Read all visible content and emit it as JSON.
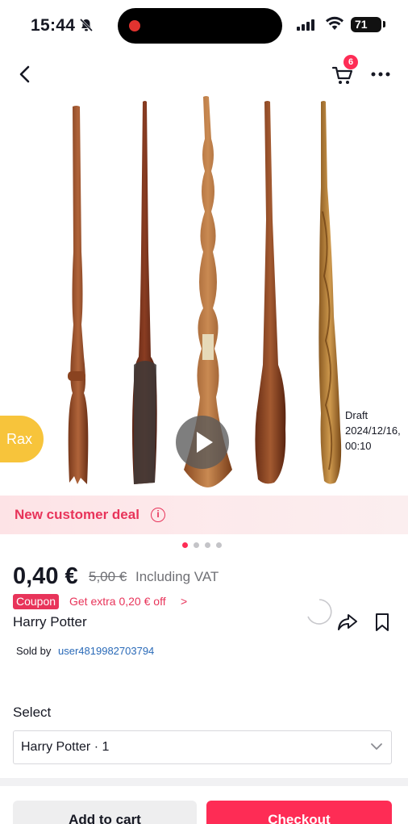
{
  "status_bar": {
    "time": "15:44",
    "battery": "71"
  },
  "nav": {
    "cart_count": "6"
  },
  "gallery": {
    "seller_badge": "Rax",
    "draft_note": "Draft 2024/12/16, 00:10",
    "slide_count": 4,
    "active_slide": 0
  },
  "deal_banner": {
    "text": "New customer deal",
    "info_glyph": "i"
  },
  "price": {
    "current": "0,40 €",
    "original": "5,00 €",
    "vat_note": "Including VAT"
  },
  "coupon": {
    "tag": "Coupon",
    "text": "Get extra 0,20 € off",
    "arrow": ">"
  },
  "product": {
    "title": "Harry Potter"
  },
  "seller": {
    "label": "Sold by",
    "name": "user4819982703794"
  },
  "variant": {
    "label": "Select",
    "selected": "Harry Potter · 1"
  },
  "actions": {
    "add_to_cart": "Add to cart",
    "checkout": "Checkout"
  },
  "colors": {
    "accent": "#fe2c55",
    "deal_text": "#e8345a",
    "link": "#2a6ab8",
    "badge": "#f7c43b"
  },
  "icons": [
    "bell-off-icon",
    "signal-icon",
    "wifi-icon",
    "battery-icon",
    "back-arrow-icon",
    "cart-icon",
    "more-icon",
    "play-icon",
    "info-icon",
    "share-icon",
    "bookmark-icon",
    "chevron-down-icon",
    "loading-spinner-icon"
  ]
}
